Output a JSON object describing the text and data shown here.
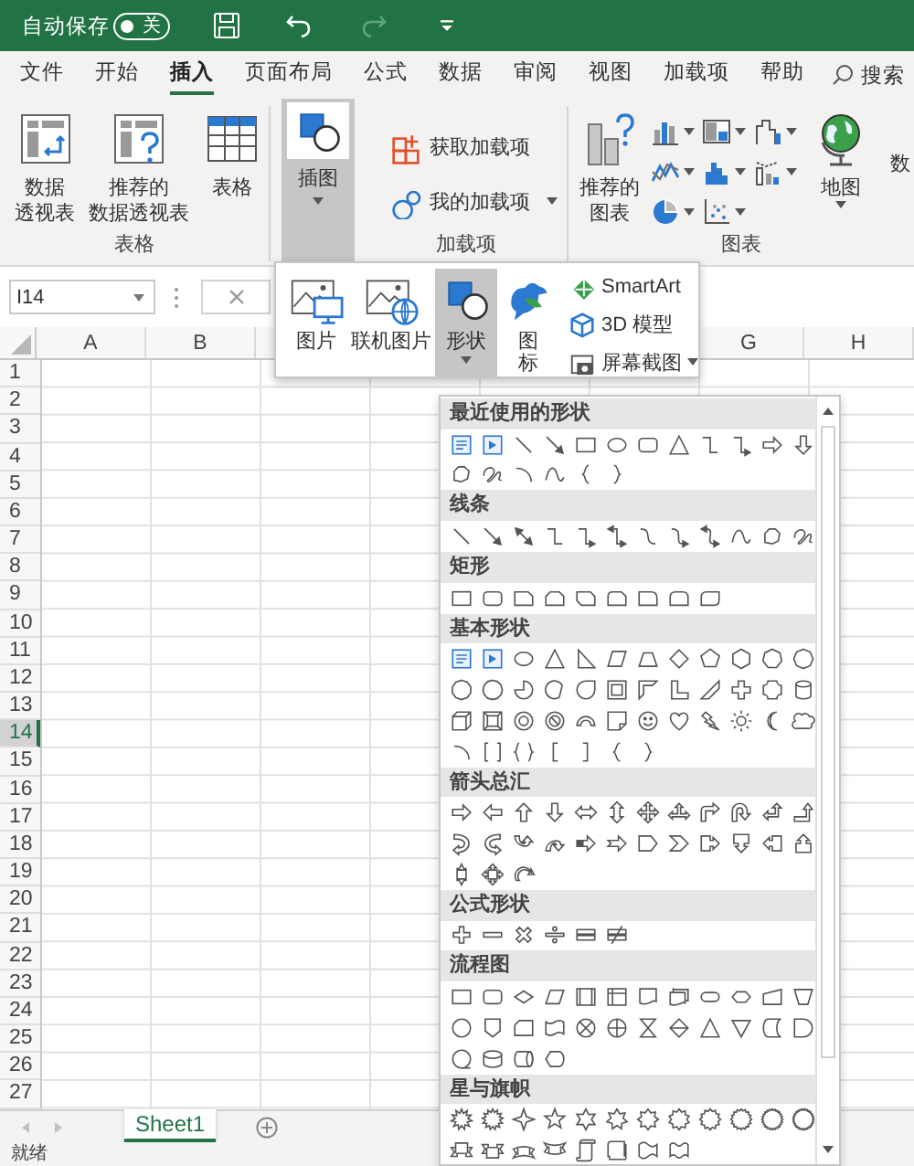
{
  "title_bar": {
    "autosave_label": "自动保存",
    "autosave": {
      "on": false,
      "label": "关"
    },
    "quick_access": [
      {
        "kind": "save",
        "disabled": false
      },
      {
        "kind": "undo",
        "disabled": false
      },
      {
        "kind": "redo",
        "disabled": true
      },
      {
        "kind": "customize",
        "disabled": false
      }
    ]
  },
  "tabs": [
    {
      "label": "文件",
      "selected": false
    },
    {
      "label": "开始",
      "selected": false
    },
    {
      "label": "插入",
      "selected": true
    },
    {
      "label": "页面布局",
      "selected": false
    },
    {
      "label": "公式",
      "selected": false
    },
    {
      "label": "数据",
      "selected": false
    },
    {
      "label": "审阅",
      "selected": false
    },
    {
      "label": "视图",
      "selected": false
    },
    {
      "label": "加载项",
      "selected": false
    },
    {
      "label": "帮助",
      "selected": false
    }
  ],
  "search": {
    "label": "搜索"
  },
  "ribbon": {
    "groups": [
      {
        "label": "表格",
        "items": [
          {
            "kind": "large",
            "lines": [
              "数据",
              "透视表"
            ]
          },
          {
            "kind": "large",
            "lines": [
              "推荐的",
              "数据透视表"
            ]
          },
          {
            "kind": "large",
            "lines": [
              "表格"
            ]
          }
        ]
      },
      {
        "items": [
          {
            "kind": "collapsed",
            "lines": [
              "插图"
            ],
            "pressed": true,
            "dropdown": true
          }
        ]
      },
      {
        "label": "加载项",
        "items": [
          {
            "kind": "small",
            "label": "获取加载项"
          },
          {
            "kind": "small",
            "label": "我的加载项",
            "dropdown": true
          }
        ]
      },
      {
        "label": "图表",
        "items": [
          {
            "kind": "large",
            "lines": [
              "推荐的",
              "图表"
            ]
          },
          {
            "kind": "chart-grid",
            "charts": [
              {
                "kind": "column"
              },
              {
                "kind": "line"
              },
              {
                "kind": "pie"
              },
              {
                "kind": "treemap"
              },
              {
                "kind": "histogram"
              },
              {
                "kind": "scatter"
              },
              {
                "kind": "waterfall"
              },
              {
                "kind": "combo"
              }
            ]
          },
          {
            "kind": "large",
            "lines": [
              "地图"
            ],
            "dropdown": true
          },
          {
            "kind": "clipped",
            "label": "数"
          }
        ]
      }
    ]
  },
  "formula_bar": {
    "name_box": "I14"
  },
  "columns": [
    {
      "label": "A"
    },
    {
      "label": "B"
    },
    {},
    {},
    {},
    {},
    {
      "label": "G"
    },
    {
      "label": "H"
    }
  ],
  "rows": [
    {
      "label": "1",
      "selected": false
    },
    {
      "label": "2",
      "selected": false
    },
    {
      "label": "3",
      "selected": false
    },
    {
      "label": "4",
      "selected": false
    },
    {
      "label": "5",
      "selected": false
    },
    {
      "label": "6",
      "selected": false
    },
    {
      "label": "7",
      "selected": false
    },
    {
      "label": "8",
      "selected": false
    },
    {
      "label": "9",
      "selected": false
    },
    {
      "label": "10",
      "selected": false
    },
    {
      "label": "11",
      "selected": false
    },
    {
      "label": "12",
      "selected": false
    },
    {
      "label": "13",
      "selected": false
    },
    {
      "label": "14",
      "selected": true
    },
    {
      "label": "15",
      "selected": false
    },
    {
      "label": "16",
      "selected": false
    },
    {
      "label": "17",
      "selected": false
    },
    {
      "label": "18",
      "selected": false
    },
    {
      "label": "19",
      "selected": false
    },
    {
      "label": "20",
      "selected": false
    },
    {
      "label": "21",
      "selected": false
    },
    {
      "label": "22",
      "selected": false
    },
    {
      "label": "23",
      "selected": false
    },
    {
      "label": "24",
      "selected": false
    },
    {
      "label": "25",
      "selected": false
    },
    {
      "label": "26",
      "selected": false
    },
    {
      "label": "27",
      "selected": false
    }
  ],
  "illustrations_menu": {
    "items": [
      {
        "kind": "large",
        "lines": [
          "图片"
        ],
        "selected": false
      },
      {
        "kind": "large",
        "lines": [
          "联机图片"
        ],
        "selected": false
      },
      {
        "kind": "large",
        "lines": [
          "形状"
        ],
        "selected": true,
        "dropdown": true
      },
      {
        "kind": "large",
        "lines": [
          "图",
          "标"
        ],
        "selected": false
      },
      {
        "kind": "small",
        "lines": [
          "SmartArt"
        ],
        "selected": false
      },
      {
        "kind": "small",
        "lines": [
          "3D 模型"
        ],
        "selected": false
      },
      {
        "kind": "small",
        "lines": [
          "屏幕截图"
        ],
        "selected": false,
        "dropdown": true
      }
    ]
  },
  "shapes_gallery": {
    "sections": [
      {
        "title": "最近使用的形状",
        "shapes": [
          {
            "kind": "textbox"
          },
          {
            "kind": "vertical-textbox"
          },
          {
            "kind": "line"
          },
          {
            "kind": "arrow-line"
          },
          {
            "kind": "rectangle"
          },
          {
            "kind": "oval"
          },
          {
            "kind": "rounded-rectangle"
          },
          {
            "kind": "triangle"
          },
          {
            "kind": "elbow-connector"
          },
          {
            "kind": "elbow-arrow-connector"
          },
          {
            "kind": "right-arrow"
          },
          {
            "kind": "down-arrow"
          },
          {
            "kind": "freeform"
          },
          {
            "kind": "scribble"
          },
          {
            "kind": "arc"
          },
          {
            "kind": "curve"
          },
          {
            "kind": "left-brace"
          },
          {
            "kind": "right-brace"
          }
        ]
      },
      {
        "title": "线条",
        "shapes": [
          {
            "kind": "line"
          },
          {
            "kind": "arrow-line"
          },
          {
            "kind": "double-arrow-line"
          },
          {
            "kind": "elbow-connector"
          },
          {
            "kind": "elbow-arrow-connector"
          },
          {
            "kind": "elbow-double-arrow-connector"
          },
          {
            "kind": "curved-connector"
          },
          {
            "kind": "curved-arrow-connector"
          },
          {
            "kind": "curved-double-arrow-connector"
          },
          {
            "kind": "curve"
          },
          {
            "kind": "freeform"
          },
          {
            "kind": "scribble"
          }
        ]
      },
      {
        "title": "矩形",
        "shapes": [
          {
            "kind": "rectangle"
          },
          {
            "kind": "rounded-rectangle"
          },
          {
            "kind": "snip-corner-rectangle"
          },
          {
            "kind": "snip-same-side-rectangle"
          },
          {
            "kind": "snip-diagonal-rectangle"
          },
          {
            "kind": "snip-round-rectangle"
          },
          {
            "kind": "round-corner-rectangle"
          },
          {
            "kind": "round-same-side-rectangle"
          },
          {
            "kind": "round-diagonal-rectangle"
          }
        ]
      },
      {
        "title": "基本形状",
        "shapes": [
          {
            "kind": "textbox"
          },
          {
            "kind": "vertical-textbox"
          },
          {
            "kind": "oval"
          },
          {
            "kind": "triangle"
          },
          {
            "kind": "right-triangle"
          },
          {
            "kind": "parallelogram"
          },
          {
            "kind": "trapezoid"
          },
          {
            "kind": "diamond"
          },
          {
            "kind": "pentagon"
          },
          {
            "kind": "hexagon"
          },
          {
            "kind": "heptagon"
          },
          {
            "kind": "octagon"
          },
          {
            "kind": "decagon"
          },
          {
            "kind": "dodecagon"
          },
          {
            "kind": "pie"
          },
          {
            "kind": "chord"
          },
          {
            "kind": "teardrop"
          },
          {
            "kind": "frame"
          },
          {
            "kind": "half-frame"
          },
          {
            "kind": "l-shape"
          },
          {
            "kind": "diagonal-stripe"
          },
          {
            "kind": "cross"
          },
          {
            "kind": "plaque"
          },
          {
            "kind": "can"
          },
          {
            "kind": "cube"
          },
          {
            "kind": "bevel"
          },
          {
            "kind": "donut"
          },
          {
            "kind": "no-symbol"
          },
          {
            "kind": "block-arc"
          },
          {
            "kind": "folded-corner"
          },
          {
            "kind": "smiley"
          },
          {
            "kind": "heart"
          },
          {
            "kind": "lightning"
          },
          {
            "kind": "sun"
          },
          {
            "kind": "moon"
          },
          {
            "kind": "cloud"
          },
          {
            "kind": "arc"
          },
          {
            "kind": "bracket-pair"
          },
          {
            "kind": "brace-pair"
          },
          {
            "kind": "left-bracket"
          },
          {
            "kind": "right-bracket"
          },
          {
            "kind": "left-brace"
          },
          {
            "kind": "right-brace"
          }
        ]
      },
      {
        "title": "箭头总汇",
        "shapes": [
          {
            "kind": "right-arrow"
          },
          {
            "kind": "left-arrow"
          },
          {
            "kind": "up-arrow"
          },
          {
            "kind": "down-arrow"
          },
          {
            "kind": "left-right-arrow"
          },
          {
            "kind": "up-down-arrow"
          },
          {
            "kind": "quad-arrow"
          },
          {
            "kind": "left-right-up-arrow"
          },
          {
            "kind": "bent-arrow"
          },
          {
            "kind": "u-turn-arrow"
          },
          {
            "kind": "left-up-arrow"
          },
          {
            "kind": "bent-up-arrow"
          },
          {
            "kind": "curved-right-arrow"
          },
          {
            "kind": "curved-left-arrow"
          },
          {
            "kind": "curved-up-arrow"
          },
          {
            "kind": "curved-down-arrow"
          },
          {
            "kind": "striped-right-arrow"
          },
          {
            "kind": "notched-right-arrow"
          },
          {
            "kind": "pentagon-arrow"
          },
          {
            "kind": "chevron"
          },
          {
            "kind": "right-arrow-callout"
          },
          {
            "kind": "down-arrow-callout"
          },
          {
            "kind": "left-arrow-callout"
          },
          {
            "kind": "up-arrow-callout"
          },
          {
            "kind": "up-down-arrow-callout"
          },
          {
            "kind": "quad-arrow-callout"
          },
          {
            "kind": "circular-arrow"
          }
        ]
      },
      {
        "title": "公式形状",
        "shapes": [
          {
            "kind": "plus"
          },
          {
            "kind": "minus"
          },
          {
            "kind": "multiply"
          },
          {
            "kind": "divide"
          },
          {
            "kind": "equal"
          },
          {
            "kind": "not-equal"
          }
        ]
      },
      {
        "title": "流程图",
        "shapes": [
          {
            "kind": "process"
          },
          {
            "kind": "alternate-process"
          },
          {
            "kind": "decision"
          },
          {
            "kind": "data"
          },
          {
            "kind": "predefined-process"
          },
          {
            "kind": "internal-storage"
          },
          {
            "kind": "document"
          },
          {
            "kind": "multidocument"
          },
          {
            "kind": "terminator"
          },
          {
            "kind": "preparation"
          },
          {
            "kind": "manual-input"
          },
          {
            "kind": "manual-operation"
          },
          {
            "kind": "connector"
          },
          {
            "kind": "off-page-connector"
          },
          {
            "kind": "card"
          },
          {
            "kind": "punched-tape"
          },
          {
            "kind": "summing-junction"
          },
          {
            "kind": "or"
          },
          {
            "kind": "collate"
          },
          {
            "kind": "sort"
          },
          {
            "kind": "extract"
          },
          {
            "kind": "merge"
          },
          {
            "kind": "stored-data"
          },
          {
            "kind": "delay"
          },
          {
            "kind": "sequential-access-storage"
          },
          {
            "kind": "magnetic-disk"
          },
          {
            "kind": "direct-access-storage"
          },
          {
            "kind": "display"
          }
        ]
      },
      {
        "title": "星与旗帜",
        "shapes": [
          {
            "kind": "explosion"
          },
          {
            "kind": "explosion-two"
          },
          {
            "kind": "star4"
          },
          {
            "kind": "star5"
          },
          {
            "kind": "star6"
          },
          {
            "kind": "star7"
          },
          {
            "kind": "star8"
          },
          {
            "kind": "star10"
          },
          {
            "kind": "star12"
          },
          {
            "kind": "star16"
          },
          {
            "kind": "star24"
          },
          {
            "kind": "star32"
          },
          {
            "kind": "ribbon-up"
          },
          {
            "kind": "ribbon-down"
          },
          {
            "kind": "curved-ribbon-up"
          },
          {
            "kind": "curved-ribbon-down"
          },
          {
            "kind": "vertical-scroll"
          },
          {
            "kind": "horizontal-scroll"
          },
          {
            "kind": "wave"
          },
          {
            "kind": "double-wave"
          }
        ]
      }
    ]
  },
  "sheets": [
    {
      "label": "Sheet1",
      "selected": true
    }
  ],
  "status_bar": {
    "text": "就绪"
  }
}
